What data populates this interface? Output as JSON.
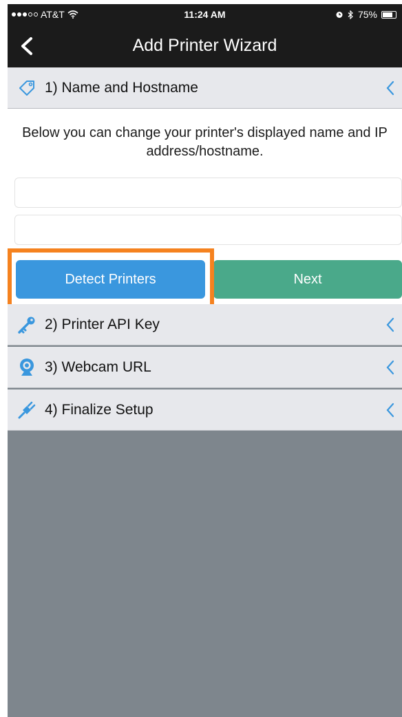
{
  "status_bar": {
    "carrier": "AT&T",
    "time": "11:24 AM",
    "battery": "75%",
    "battery_level": 0.75
  },
  "nav": {
    "title": "Add Printer Wizard",
    "back_icon": "back-chevron-icon"
  },
  "sections": [
    {
      "label": "1) Name and Hostname",
      "icon": "tag-icon"
    },
    {
      "label": "2) Printer API Key",
      "icon": "key-icon"
    },
    {
      "label": "3) Webcam URL",
      "icon": "webcam-icon"
    },
    {
      "label": "4) Finalize Setup",
      "icon": "plug-icon"
    }
  ],
  "step1": {
    "description": "Below you can change your printer's displayed name and IP address/hostname.",
    "name_field": {
      "value": "",
      "placeholder": ""
    },
    "host_field": {
      "value": "",
      "placeholder": ""
    },
    "detect_label": "Detect Printers",
    "next_label": "Next"
  },
  "colors": {
    "accent_blue": "#3a97de",
    "next_green": "#4aa98a",
    "highlight_orange": "#f5821f",
    "icon_blue": "#3a97de"
  }
}
